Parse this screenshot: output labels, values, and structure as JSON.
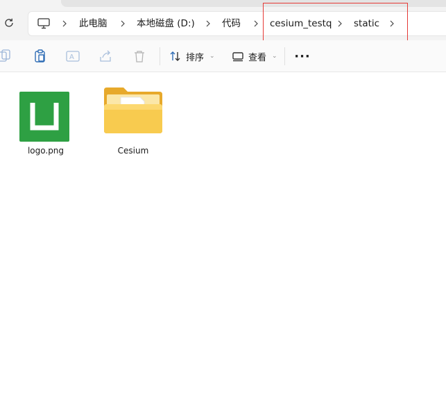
{
  "address": {
    "breadcrumbs": [
      "此电脑",
      "本地磁盘 (D:)",
      "代码",
      "cesium_testq",
      "static"
    ]
  },
  "toolbar": {
    "sort_label": "排序",
    "view_label": "查看",
    "more_label": "···"
  },
  "files": [
    {
      "name": "logo.png",
      "icon": "png-image-icon",
      "color": "#2ea043"
    },
    {
      "name": "Cesium",
      "icon": "folder-icon",
      "color": "#f5c542"
    }
  ],
  "highlight": {
    "color": "#e53935"
  }
}
